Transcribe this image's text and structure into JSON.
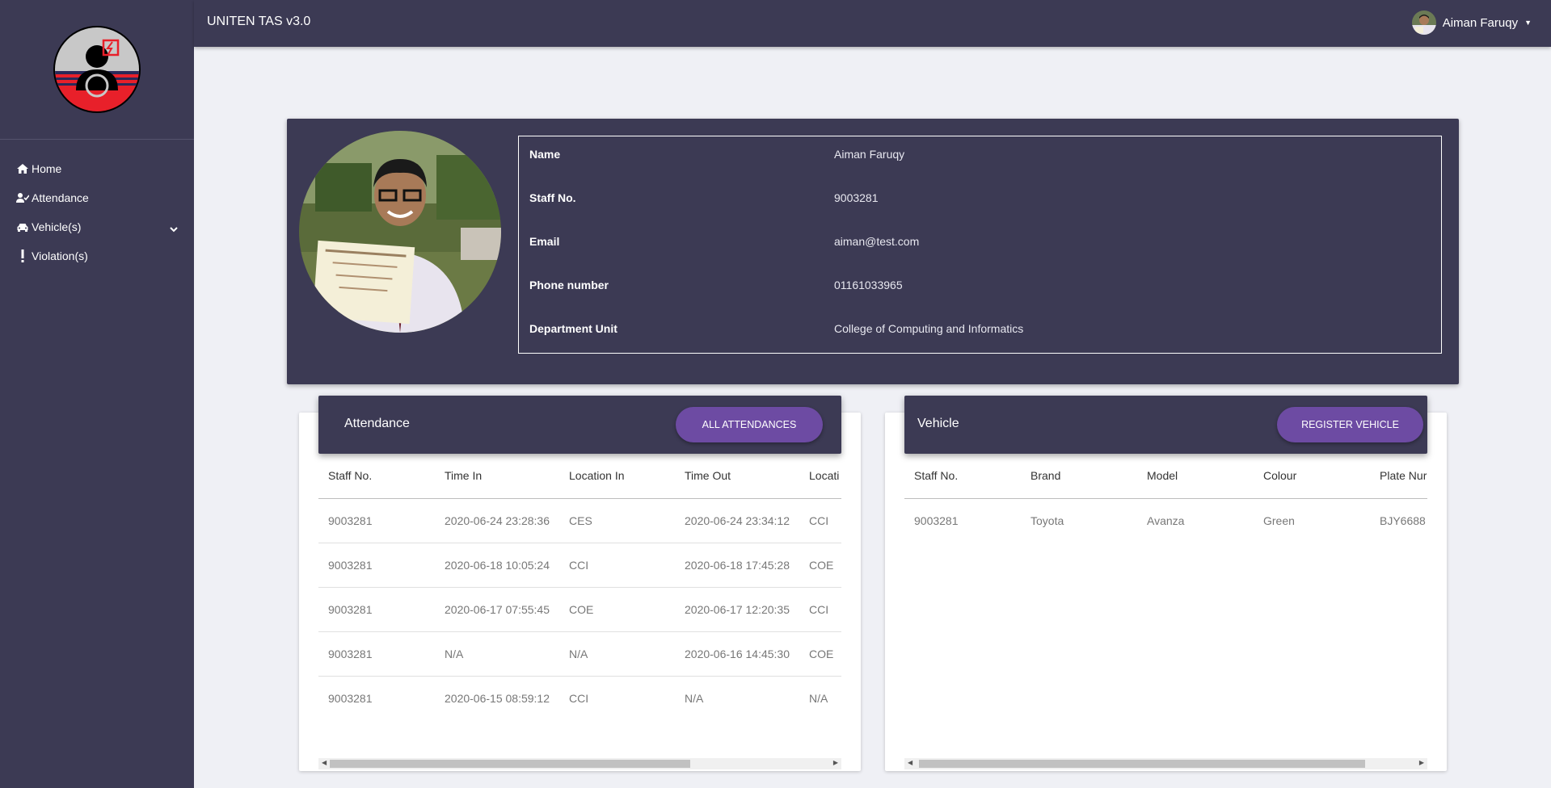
{
  "app": {
    "title": "UNITEN TAS v3.0"
  },
  "user": {
    "name": "Aiman Faruqy"
  },
  "sidebar": {
    "items": [
      {
        "label": "Home",
        "icon": "home-icon"
      },
      {
        "label": "Attendance",
        "icon": "user-check-icon"
      },
      {
        "label": "Vehicle(s)",
        "icon": "car-icon",
        "has_submenu": true
      },
      {
        "label": "Violation(s)",
        "icon": "exclamation-icon"
      }
    ]
  },
  "profile": {
    "fields": [
      {
        "label": "Name",
        "value": "Aiman Faruqy"
      },
      {
        "label": "Staff No.",
        "value": "9003281"
      },
      {
        "label": "Email",
        "value": "aiman@test.com"
      },
      {
        "label": "Phone number",
        "value": "01161033965"
      },
      {
        "label": "Department Unit",
        "value": "College of Computing and Informatics"
      }
    ]
  },
  "attendance": {
    "title": "Attendance",
    "button": "ALL ATTENDANCES",
    "columns": [
      "Staff No.",
      "Time In",
      "Location In",
      "Time Out",
      "Locati"
    ],
    "rows": [
      [
        "9003281",
        "2020-06-24 23:28:36",
        "CES",
        "2020-06-24 23:34:12",
        "CCI"
      ],
      [
        "9003281",
        "2020-06-18 10:05:24",
        "CCI",
        "2020-06-18 17:45:28",
        "COE"
      ],
      [
        "9003281",
        "2020-06-17 07:55:45",
        "COE",
        "2020-06-17 12:20:35",
        "CCI"
      ],
      [
        "9003281",
        "N/A",
        "N/A",
        "2020-06-16 14:45:30",
        "COE"
      ],
      [
        "9003281",
        "2020-06-15 08:59:12",
        "CCI",
        "N/A",
        "N/A"
      ]
    ]
  },
  "vehicle": {
    "title": "Vehicle",
    "button": "REGISTER VEHICLE",
    "columns": [
      "Staff No.",
      "Brand",
      "Model",
      "Colour",
      "Plate Nur"
    ],
    "rows": [
      [
        "9003281",
        "Toyota",
        "Avanza",
        "Green",
        "BJY6688"
      ]
    ]
  },
  "colors": {
    "sidebar": "#3c3a54",
    "accent": "#6d4ba3",
    "background": "#eff0f5"
  }
}
